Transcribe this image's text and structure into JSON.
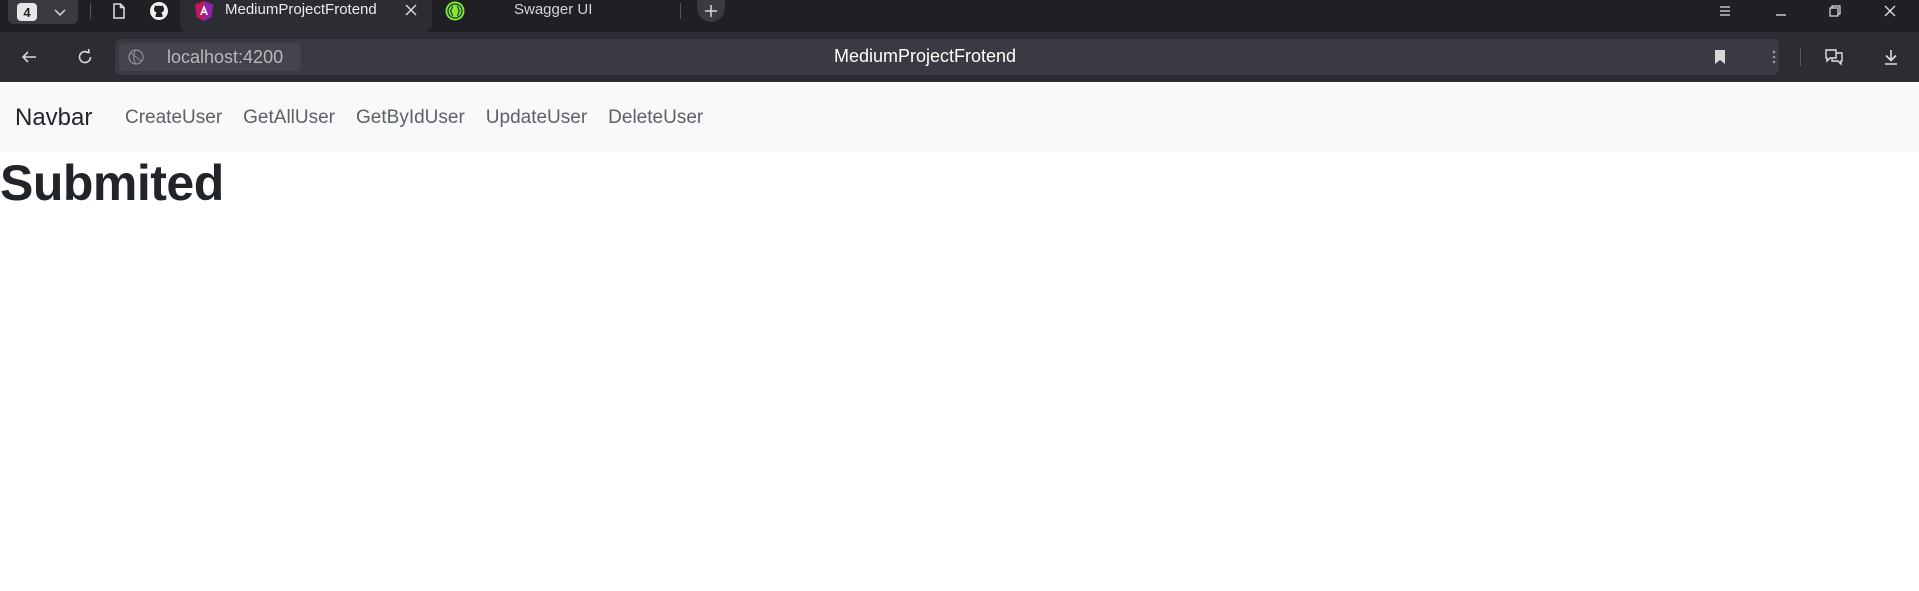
{
  "browser": {
    "tab_count": "4",
    "tabs": [
      {
        "title": "MediumProjectFrotend",
        "active": true
      },
      {
        "title": "Swagger UI",
        "active": false
      }
    ],
    "address": {
      "url": "localhost:4200",
      "page_title": "MediumProjectFrotend"
    }
  },
  "app": {
    "navbar": {
      "brand": "Navbar",
      "links": [
        "CreateUser",
        "GetAllUser",
        "GetByIdUser",
        "UpdateUser",
        "DeleteUser"
      ]
    },
    "heading": "Submited"
  },
  "colors": {
    "tabstrip_bg": "#1f1f24",
    "toolbar_bg": "#2c2c33",
    "navbar_bg": "#f8f9fa",
    "text_dark": "#212529",
    "nav_link": "#5c6166"
  },
  "icons": {
    "tab_strip": [
      "tab-list-chevron-icon",
      "page-icon",
      "github-icon"
    ],
    "active_tab_favicon": "angular-icon",
    "inactive_tab_favicon": "swagger-icon",
    "window": [
      "menu-icon",
      "minimize-icon",
      "restore-icon",
      "close-icon"
    ],
    "toolbar": [
      "back-arrow-icon",
      "reload-icon",
      "globe-icon",
      "bookmark-icon",
      "more-vertical-icon",
      "chat-icon",
      "download-icon"
    ]
  }
}
